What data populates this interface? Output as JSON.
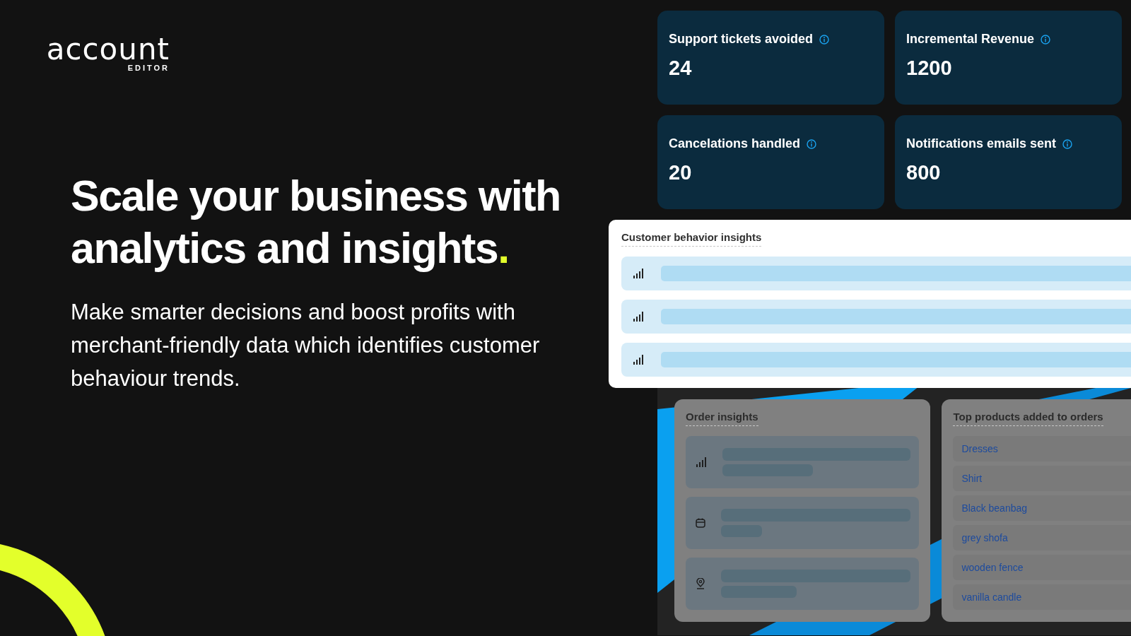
{
  "logo": {
    "wordmark": "account",
    "subtitle": "EDITOR"
  },
  "headline": {
    "text": "Scale your business with analytics and insights",
    "accent": "."
  },
  "description": "Make smarter decisions and boost profits with merchant-friendly data which identifies customer behaviour trends.",
  "stat_cards": [
    {
      "label": "Support tickets avoided",
      "value": "24"
    },
    {
      "label": "Incremental Revenue",
      "value": "1200"
    },
    {
      "label": "Cancelations handled",
      "value": "20"
    },
    {
      "label": "Notifications emails sent",
      "value": "800"
    }
  ],
  "customer_insights": {
    "title": "Customer behavior insights",
    "rows": [
      {
        "kind": "signal"
      },
      {
        "kind": "signal"
      },
      {
        "kind": "signal"
      }
    ]
  },
  "order_insights": {
    "title": "Order insights",
    "rows": [
      {
        "kind": "signal"
      },
      {
        "kind": "calendar"
      },
      {
        "kind": "location"
      }
    ]
  },
  "top_products": {
    "title": "Top products added to orders",
    "items": [
      "Dresses",
      "Shirt",
      "Black beanbag",
      "grey shofa",
      "wooden fence",
      "vanilla candle"
    ]
  }
}
